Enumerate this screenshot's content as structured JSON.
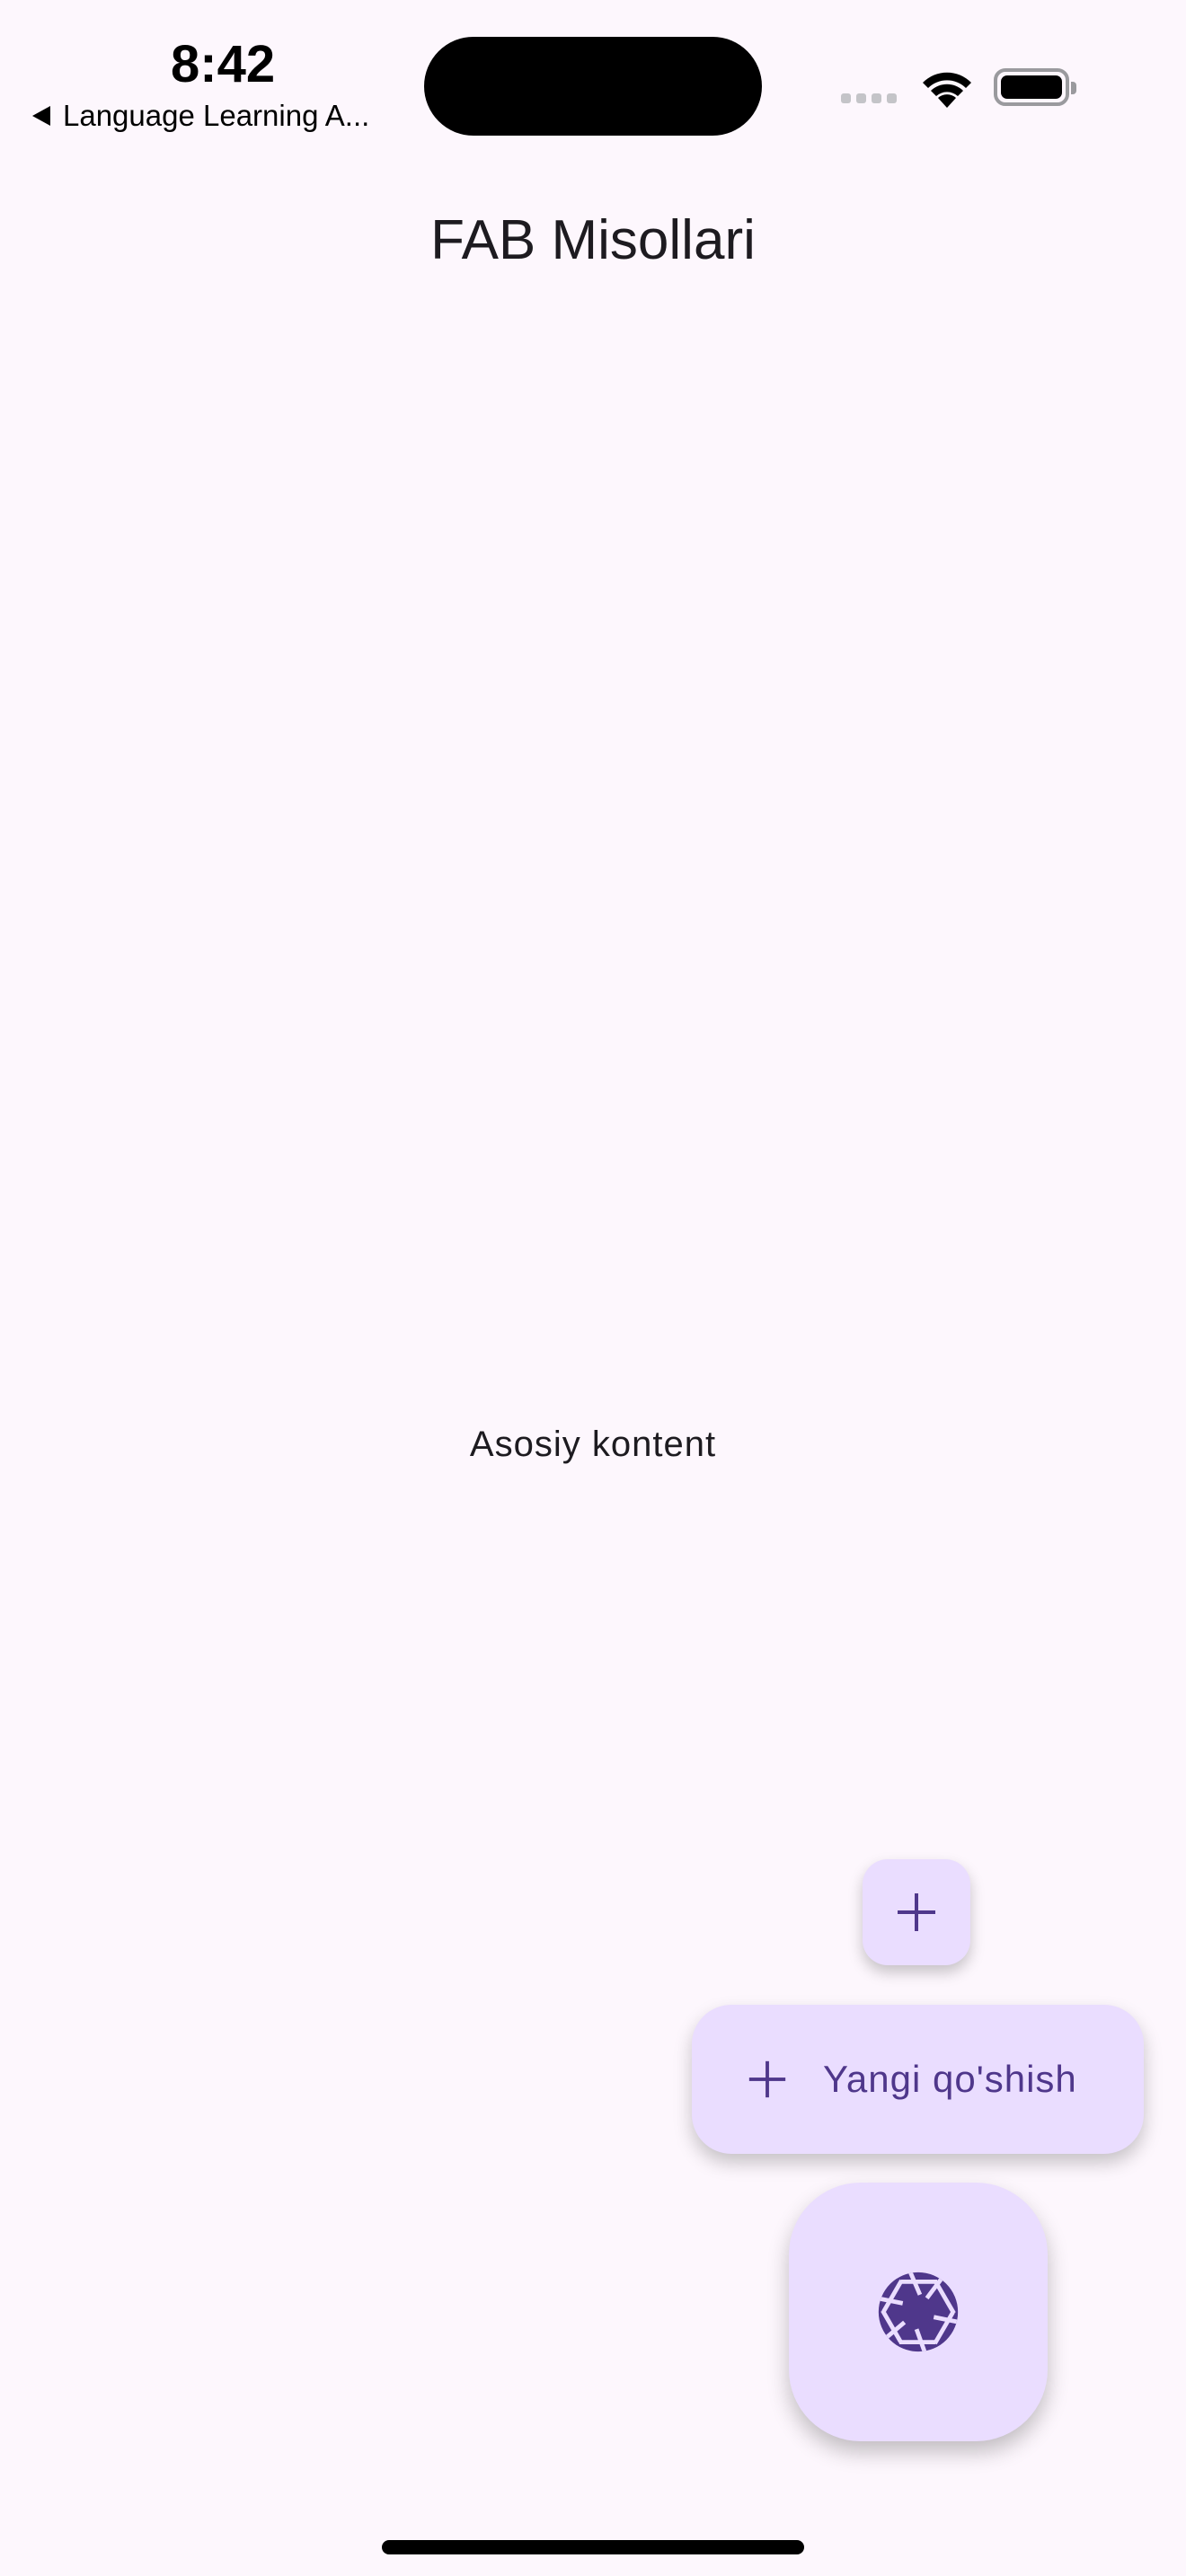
{
  "status_bar": {
    "time": "8:42",
    "back_app": "Language Learning A...",
    "icons": [
      "signal-icon",
      "wifi-icon",
      "battery-icon"
    ]
  },
  "app_bar": {
    "title": "FAB Misollari"
  },
  "body": {
    "text": "Asosiy kontent"
  },
  "fabs": {
    "small": {
      "icon": "plus-icon"
    },
    "extended": {
      "icon": "plus-icon",
      "label": "Yangi qo'shish"
    },
    "large": {
      "icon": "camera-aperture-icon"
    }
  },
  "colors": {
    "background": "#FDF7FD",
    "fab_container": "#EADDFF",
    "fab_content": "#4F378B",
    "text": "#1D1B20"
  }
}
